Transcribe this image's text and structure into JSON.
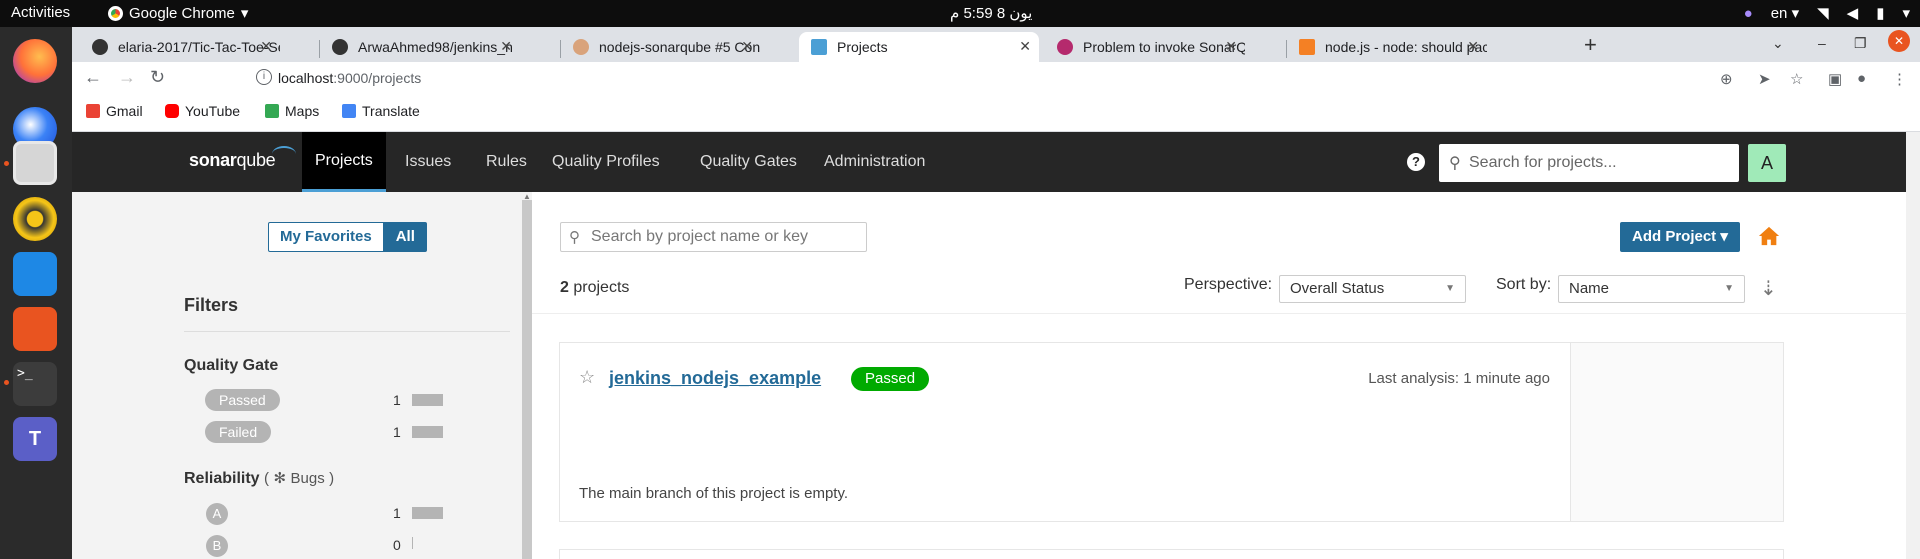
{
  "os": {
    "activities": "Activities",
    "app_name": "Google Chrome",
    "clock": "يون 8  5:59 م",
    "lang": "en"
  },
  "tabs": [
    {
      "title": "elaria-2017/Tic-Tac-Toe-Se"
    },
    {
      "title": "ArwaAhmed98/jenkins_n"
    },
    {
      "title": "nodejs-sonarqube #5 Con"
    },
    {
      "title": "Projects"
    },
    {
      "title": "Problem to invoke SonarQ"
    },
    {
      "title": "node.js - node: should pac"
    }
  ],
  "omnibox": {
    "host": "localhost",
    "path": ":9000/projects"
  },
  "bookmarks": [
    {
      "label": "Gmail"
    },
    {
      "label": "YouTube"
    },
    {
      "label": "Maps"
    },
    {
      "label": "Translate"
    }
  ],
  "sonar": {
    "logo_a": "sonar",
    "logo_b": "qube",
    "nav": [
      "Projects",
      "Issues",
      "Rules",
      "Quality Profiles",
      "Quality Gates",
      "Administration"
    ],
    "help": "?",
    "search_placeholder": "Search for projects...",
    "avatar": "A"
  },
  "sidebar": {
    "my_favorites": "My Favorites",
    "all": "All",
    "filters": "Filters",
    "quality_gate": {
      "title": "Quality Gate",
      "items": [
        {
          "label": "Passed",
          "count": "1",
          "fraction": 1.0
        },
        {
          "label": "Failed",
          "count": "1",
          "fraction": 1.0
        }
      ]
    },
    "reliability": {
      "title": "Reliability",
      "paren_open": "(",
      "sub": "Bugs",
      "paren_close": ")",
      "items": [
        {
          "label": "A",
          "count": "1",
          "fraction": 1.0
        },
        {
          "label": "B",
          "count": "0",
          "fraction": 0.0
        }
      ]
    }
  },
  "main": {
    "search_placeholder": "Search by project name or key",
    "add_project": "Add Project",
    "project_count": "2",
    "projects_word": "projects",
    "perspective_label": "Perspective:",
    "perspective_value": "Overall Status",
    "sort_label": "Sort by:",
    "sort_value": "Name",
    "project": {
      "name": "jenkins_nodejs_example",
      "status": "Passed",
      "last_analysis": "Last analysis: 1 minute ago",
      "empty_note": "The main branch of this project is empty."
    }
  },
  "colors": {
    "sonar_nav": "#262626",
    "accent_blue": "#236a97",
    "passed_green": "#00aa00",
    "avatar_green": "#a0eab8",
    "home_orange": "#f07f11"
  }
}
